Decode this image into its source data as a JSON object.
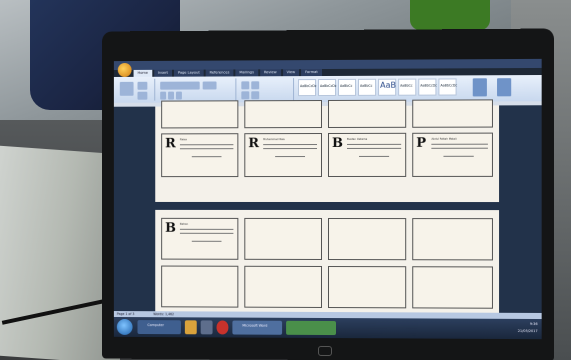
{
  "word": {
    "tabs": [
      "Home",
      "Insert",
      "Page Layout",
      "References",
      "Mailings",
      "Review",
      "View",
      "Format"
    ],
    "styles": [
      "AaBbCcDc",
      "AaBbCcDc",
      "AaBbCc",
      "AaBbCc",
      "AaB",
      "AaBbCc",
      "AaBbCcDc",
      "AaBbCcDc"
    ],
    "labels": [
      {
        "letter": "R",
        "text": "Raisa"
      },
      {
        "letter": "R",
        "text": "Muhammad Rais"
      },
      {
        "letter": "B",
        "text": "Bustan Oetama"
      },
      {
        "letter": "P",
        "text": "Abdul Fattah Matali"
      },
      {
        "letter": "B",
        "text": "Bahan"
      }
    ],
    "status_left": "Page 1 of 3",
    "status_words": "Words: 1,462"
  },
  "taskbar": {
    "item1": "Computer",
    "item2": "Microsoft Word",
    "tray_time": "9:36",
    "tray_date": "21/05/2017"
  }
}
